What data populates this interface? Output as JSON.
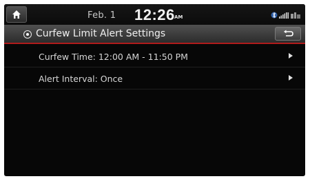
{
  "status_bar": {
    "date": "Feb. 1",
    "time": "12:26",
    "ampm": "AM",
    "icons": [
      "bluetooth-icon",
      "signal-strength-icon",
      "network-icon"
    ]
  },
  "header": {
    "title": "Curfew Limit Alert Settings",
    "home_icon": "home-icon",
    "back_icon": "back-arrow-icon"
  },
  "settings": [
    {
      "label": "Curfew Time: 12:00 AM - 11:50 PM"
    },
    {
      "label": "Alert Interval: Once"
    }
  ],
  "colors": {
    "accent_line": "#b11b1b",
    "background": "#070707"
  }
}
